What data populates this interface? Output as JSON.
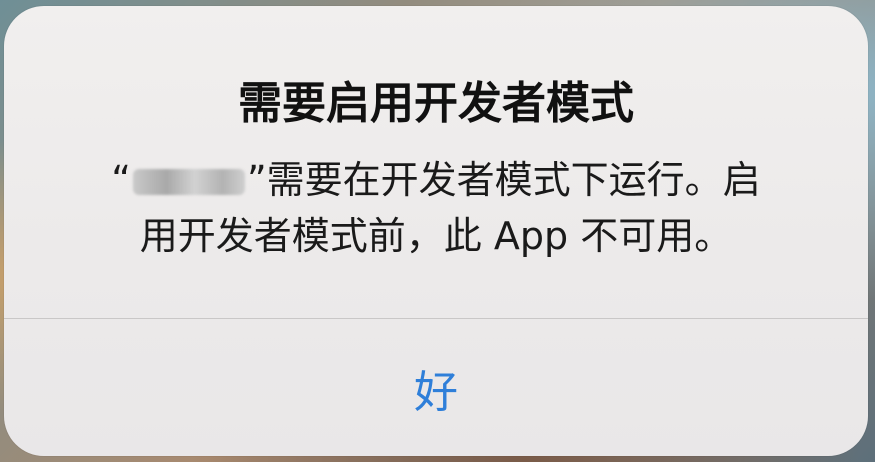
{
  "alert": {
    "title": "需要启用开发者模式",
    "message": {
      "open_quote": "“",
      "close_quote": "”",
      "line1_suffix": "需要在开发者模式下运行。启",
      "line2": "用开发者模式前，此 App 不可用。"
    },
    "ok_label": "好"
  },
  "colors": {
    "accent": "#2f7fd9",
    "alert_background": "#eceaea",
    "text": "#111111"
  }
}
